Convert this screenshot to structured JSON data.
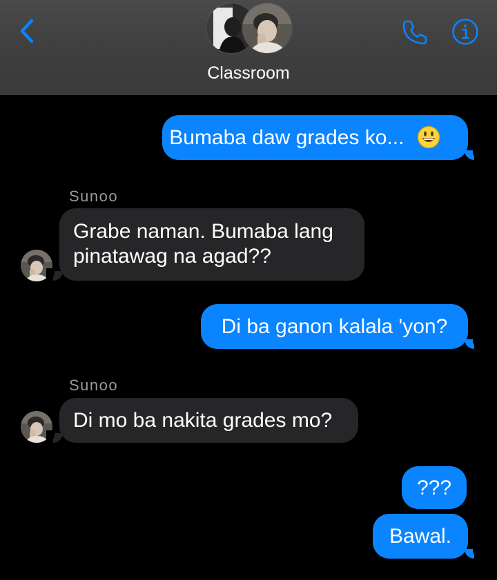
{
  "header": {
    "group_name": "Classroom"
  },
  "messages": [
    {
      "direction": "out",
      "text": "Bumaba daw grades ko...",
      "emoji": "grinning-face-emoji"
    },
    {
      "direction": "in",
      "sender": "Sunoo",
      "lines": [
        "Grabe naman. Bumaba lang",
        "pinatawag na agad??"
      ]
    },
    {
      "direction": "out",
      "text": "Di ba ganon kalala 'yon?"
    },
    {
      "direction": "in",
      "sender": "Sunoo",
      "text": "Di mo ba nakita grades mo?"
    },
    {
      "direction": "out",
      "text": "???"
    },
    {
      "direction": "out",
      "text": "Bawal."
    }
  ],
  "colors": {
    "outgoing_bubble": "#0a84ff",
    "incoming_bubble": "#262628",
    "header_background": "#434343",
    "accent": "#0a84ff",
    "sender_name": "#9a9a9f"
  },
  "icons": [
    "chevron-left-icon",
    "phone-icon",
    "info-icon"
  ]
}
